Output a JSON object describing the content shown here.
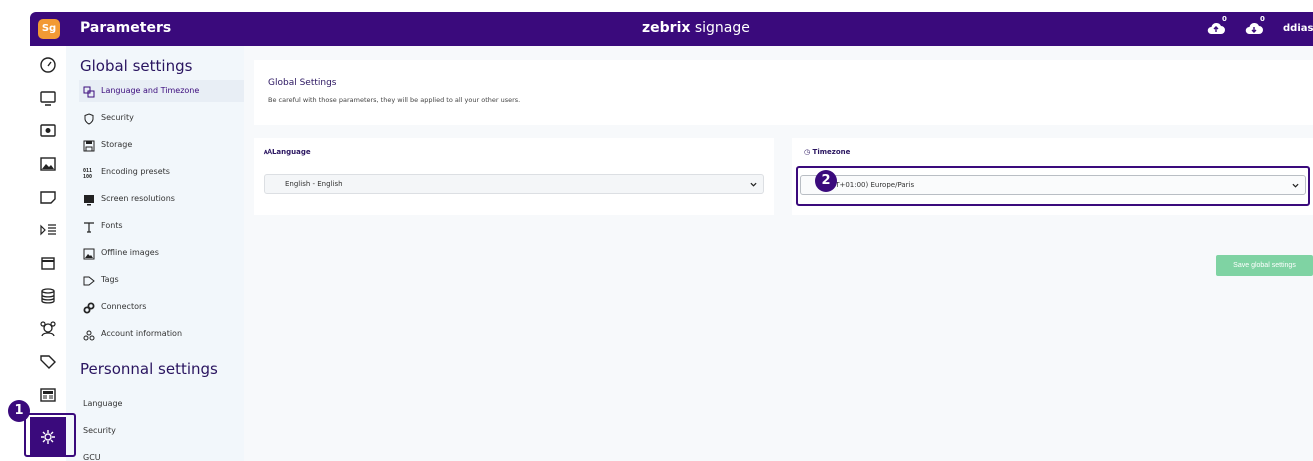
{
  "header": {
    "logo": "Sg",
    "title": "Parameters",
    "brand_bold": "zebrix",
    "brand_rest": " signage",
    "cloud_badge_1": "0",
    "cloud_badge_2": "0",
    "username": "ddias",
    "bar_color": "#3a0a7c"
  },
  "rail": {
    "icons": [
      "dashboard-icon",
      "monitor-icon",
      "player-icon",
      "image-icon",
      "media-icon",
      "playlist-icon",
      "calendar-icon",
      "database-icon",
      "users-icon",
      "tag-icon",
      "news-icon",
      "settings-gear-icon"
    ]
  },
  "nav": {
    "global_heading": "Global settings",
    "global_items": [
      {
        "label": "Language and Timezone",
        "icon": "language-icon"
      },
      {
        "label": "Security",
        "icon": "shield-icon"
      },
      {
        "label": "Storage",
        "icon": "floppy-icon"
      },
      {
        "label": "Encoding presets",
        "icon": "binary-icon"
      },
      {
        "label": "Screen resolutions",
        "icon": "screen-icon"
      },
      {
        "label": "Fonts",
        "icon": "font-icon"
      },
      {
        "label": "Offline images",
        "icon": "image-icon"
      },
      {
        "label": "Tags",
        "icon": "tags-icon"
      },
      {
        "label": "Connectors",
        "icon": "link-icon"
      },
      {
        "label": "Account information",
        "icon": "account-icon"
      }
    ],
    "personal_heading": "Personnal settings",
    "personal_items": [
      "Language",
      "Security",
      "GCU"
    ]
  },
  "main": {
    "info_title": "Global Settings",
    "info_desc": "Be careful with those parameters, they will be applied to all your other users.",
    "language_title": "Language",
    "language_value": "English - English",
    "timezone_title": "Timezone",
    "timezone_value": "(GMT+01:00) Europe/Paris",
    "save_label": "Save global settings",
    "save_color": "#7fd3a3"
  },
  "annotations": {
    "step1": "1",
    "step2": "2"
  }
}
